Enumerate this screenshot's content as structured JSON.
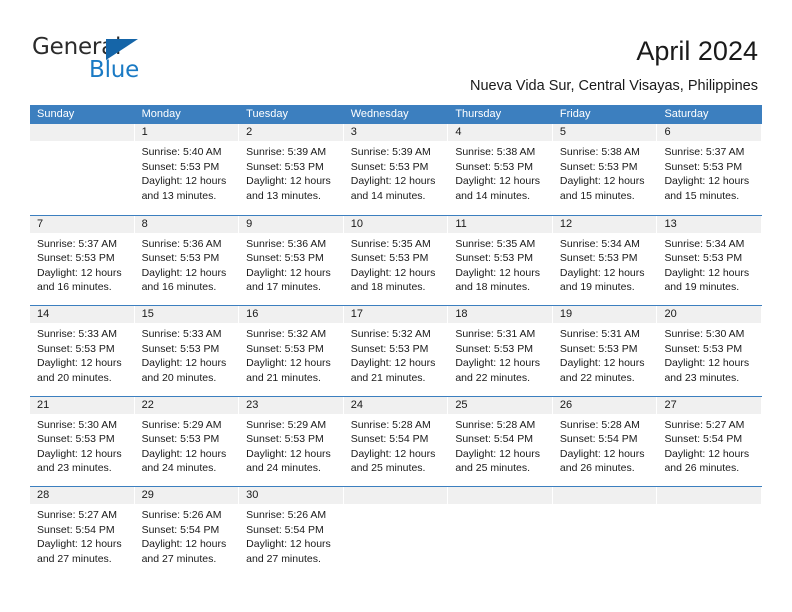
{
  "brand": {
    "name_top": "General",
    "name_bottom": "Blue",
    "accent_color": "#1a7ac4",
    "triangle_color": "#1565a8"
  },
  "header": {
    "title": "April 2024",
    "subtitle": "Nueva Vida Sur, Central Visayas, Philippines"
  },
  "calendar": {
    "header_bg": "#3C7FBF",
    "day_band_bg": "#F0F0F0",
    "weekdays": [
      "Sunday",
      "Monday",
      "Tuesday",
      "Wednesday",
      "Thursday",
      "Friday",
      "Saturday"
    ],
    "weeks": [
      [
        {
          "day": "",
          "lines": []
        },
        {
          "day": "1",
          "lines": [
            "Sunrise: 5:40 AM",
            "Sunset: 5:53 PM",
            "Daylight: 12 hours",
            "and 13 minutes."
          ]
        },
        {
          "day": "2",
          "lines": [
            "Sunrise: 5:39 AM",
            "Sunset: 5:53 PM",
            "Daylight: 12 hours",
            "and 13 minutes."
          ]
        },
        {
          "day": "3",
          "lines": [
            "Sunrise: 5:39 AM",
            "Sunset: 5:53 PM",
            "Daylight: 12 hours",
            "and 14 minutes."
          ]
        },
        {
          "day": "4",
          "lines": [
            "Sunrise: 5:38 AM",
            "Sunset: 5:53 PM",
            "Daylight: 12 hours",
            "and 14 minutes."
          ]
        },
        {
          "day": "5",
          "lines": [
            "Sunrise: 5:38 AM",
            "Sunset: 5:53 PM",
            "Daylight: 12 hours",
            "and 15 minutes."
          ]
        },
        {
          "day": "6",
          "lines": [
            "Sunrise: 5:37 AM",
            "Sunset: 5:53 PM",
            "Daylight: 12 hours",
            "and 15 minutes."
          ]
        }
      ],
      [
        {
          "day": "7",
          "lines": [
            "Sunrise: 5:37 AM",
            "Sunset: 5:53 PM",
            "Daylight: 12 hours",
            "and 16 minutes."
          ]
        },
        {
          "day": "8",
          "lines": [
            "Sunrise: 5:36 AM",
            "Sunset: 5:53 PM",
            "Daylight: 12 hours",
            "and 16 minutes."
          ]
        },
        {
          "day": "9",
          "lines": [
            "Sunrise: 5:36 AM",
            "Sunset: 5:53 PM",
            "Daylight: 12 hours",
            "and 17 minutes."
          ]
        },
        {
          "day": "10",
          "lines": [
            "Sunrise: 5:35 AM",
            "Sunset: 5:53 PM",
            "Daylight: 12 hours",
            "and 18 minutes."
          ]
        },
        {
          "day": "11",
          "lines": [
            "Sunrise: 5:35 AM",
            "Sunset: 5:53 PM",
            "Daylight: 12 hours",
            "and 18 minutes."
          ]
        },
        {
          "day": "12",
          "lines": [
            "Sunrise: 5:34 AM",
            "Sunset: 5:53 PM",
            "Daylight: 12 hours",
            "and 19 minutes."
          ]
        },
        {
          "day": "13",
          "lines": [
            "Sunrise: 5:34 AM",
            "Sunset: 5:53 PM",
            "Daylight: 12 hours",
            "and 19 minutes."
          ]
        }
      ],
      [
        {
          "day": "14",
          "lines": [
            "Sunrise: 5:33 AM",
            "Sunset: 5:53 PM",
            "Daylight: 12 hours",
            "and 20 minutes."
          ]
        },
        {
          "day": "15",
          "lines": [
            "Sunrise: 5:33 AM",
            "Sunset: 5:53 PM",
            "Daylight: 12 hours",
            "and 20 minutes."
          ]
        },
        {
          "day": "16",
          "lines": [
            "Sunrise: 5:32 AM",
            "Sunset: 5:53 PM",
            "Daylight: 12 hours",
            "and 21 minutes."
          ]
        },
        {
          "day": "17",
          "lines": [
            "Sunrise: 5:32 AM",
            "Sunset: 5:53 PM",
            "Daylight: 12 hours",
            "and 21 minutes."
          ]
        },
        {
          "day": "18",
          "lines": [
            "Sunrise: 5:31 AM",
            "Sunset: 5:53 PM",
            "Daylight: 12 hours",
            "and 22 minutes."
          ]
        },
        {
          "day": "19",
          "lines": [
            "Sunrise: 5:31 AM",
            "Sunset: 5:53 PM",
            "Daylight: 12 hours",
            "and 22 minutes."
          ]
        },
        {
          "day": "20",
          "lines": [
            "Sunrise: 5:30 AM",
            "Sunset: 5:53 PM",
            "Daylight: 12 hours",
            "and 23 minutes."
          ]
        }
      ],
      [
        {
          "day": "21",
          "lines": [
            "Sunrise: 5:30 AM",
            "Sunset: 5:53 PM",
            "Daylight: 12 hours",
            "and 23 minutes."
          ]
        },
        {
          "day": "22",
          "lines": [
            "Sunrise: 5:29 AM",
            "Sunset: 5:53 PM",
            "Daylight: 12 hours",
            "and 24 minutes."
          ]
        },
        {
          "day": "23",
          "lines": [
            "Sunrise: 5:29 AM",
            "Sunset: 5:53 PM",
            "Daylight: 12 hours",
            "and 24 minutes."
          ]
        },
        {
          "day": "24",
          "lines": [
            "Sunrise: 5:28 AM",
            "Sunset: 5:54 PM",
            "Daylight: 12 hours",
            "and 25 minutes."
          ]
        },
        {
          "day": "25",
          "lines": [
            "Sunrise: 5:28 AM",
            "Sunset: 5:54 PM",
            "Daylight: 12 hours",
            "and 25 minutes."
          ]
        },
        {
          "day": "26",
          "lines": [
            "Sunrise: 5:28 AM",
            "Sunset: 5:54 PM",
            "Daylight: 12 hours",
            "and 26 minutes."
          ]
        },
        {
          "day": "27",
          "lines": [
            "Sunrise: 5:27 AM",
            "Sunset: 5:54 PM",
            "Daylight: 12 hours",
            "and 26 minutes."
          ]
        }
      ],
      [
        {
          "day": "28",
          "lines": [
            "Sunrise: 5:27 AM",
            "Sunset: 5:54 PM",
            "Daylight: 12 hours",
            "and 27 minutes."
          ]
        },
        {
          "day": "29",
          "lines": [
            "Sunrise: 5:26 AM",
            "Sunset: 5:54 PM",
            "Daylight: 12 hours",
            "and 27 minutes."
          ]
        },
        {
          "day": "30",
          "lines": [
            "Sunrise: 5:26 AM",
            "Sunset: 5:54 PM",
            "Daylight: 12 hours",
            "and 27 minutes."
          ]
        },
        {
          "day": "",
          "lines": []
        },
        {
          "day": "",
          "lines": []
        },
        {
          "day": "",
          "lines": []
        },
        {
          "day": "",
          "lines": []
        }
      ]
    ]
  }
}
